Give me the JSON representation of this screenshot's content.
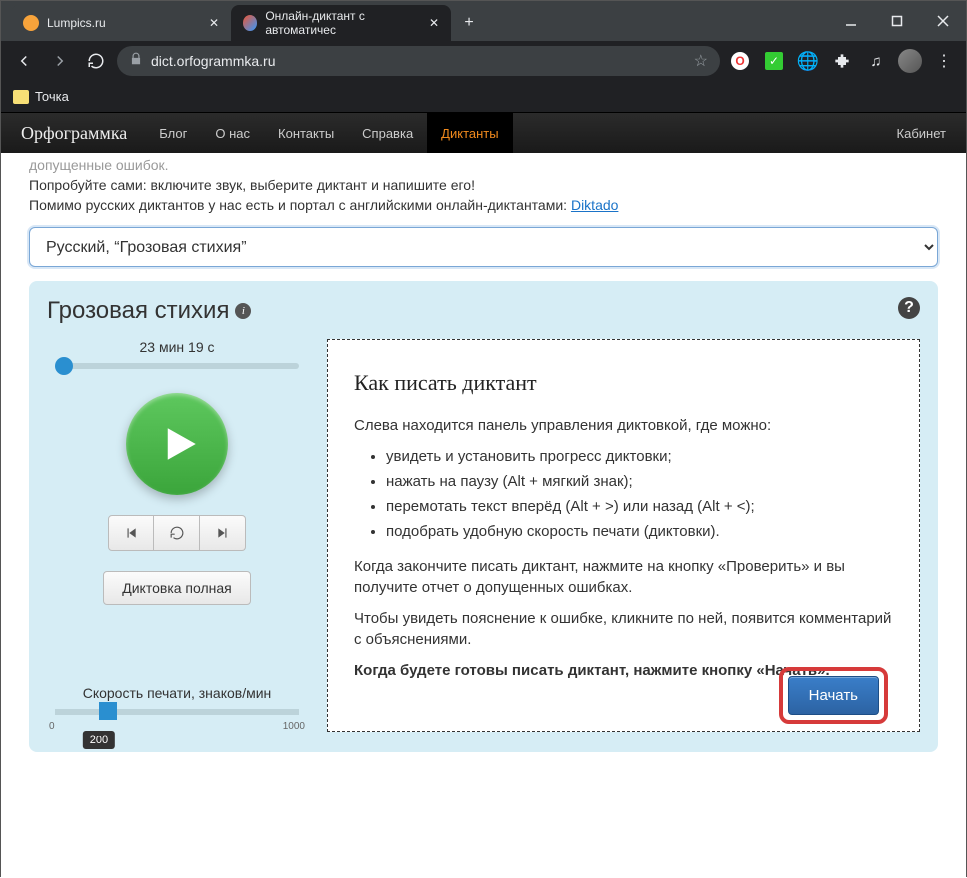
{
  "window": {
    "tab1": "Lumpics.ru",
    "tab2": "Онлайн-диктант с автоматичес"
  },
  "url": "dict.orfogrammka.ru",
  "bookmark": "Точка",
  "app": {
    "logo": "Орфограммка",
    "nav": {
      "blog": "Блог",
      "about": "О нас",
      "contacts": "Контакты",
      "help": "Справка",
      "dict": "Диктанты"
    },
    "cabinet": "Кабинет"
  },
  "intro": {
    "cut": "допущенные ошибок.",
    "p1": "Попробуйте сами: включите звук, выберите диктант и напишите его!",
    "p2a": "Помимо русских диктантов у нас есть и портал с английскими онлайн-диктантами: ",
    "p2link": "Diktado"
  },
  "select": "Русский, “Грозовая стихия”",
  "card": {
    "title": "Грозовая стихия",
    "duration": "23 мин 19 с",
    "fullbtn": "Диктовка полная",
    "speedlabel": "Скорость печати, знаков/мин",
    "speedmin": "0",
    "speedmax": "1000",
    "speedval": "200"
  },
  "howto": {
    "title": "Как писать диктант",
    "p1": "Слева находится панель управления диктовкой, где можно:",
    "li1": "увидеть и установить прогресс диктовки;",
    "li2": "нажать на паузу (Alt + мягкий знак);",
    "li3": "перемотать текст вперёд (Alt + >) или назад (Alt + <);",
    "li4": "подобрать удобную скорость печати (диктовки).",
    "p2": "Когда закончите писать диктант, нажмите на кнопку «Проверить» и вы получите отчет о допущенных ошибках.",
    "p3": "Чтобы увидеть пояснение к ошибке, кликните по ней, появится комментарий с объяснениями.",
    "p4": "Когда будете готовы писать диктант, нажмите кнопку «Начать»."
  },
  "start": "Начать"
}
